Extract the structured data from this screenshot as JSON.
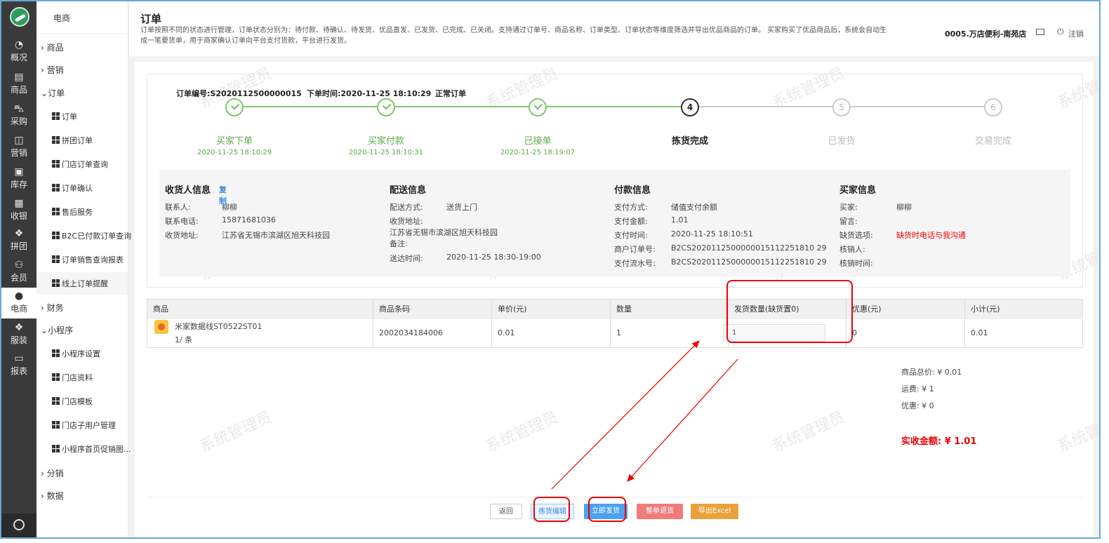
{
  "rail": {
    "items": [
      "概况",
      "商品",
      "采购",
      "营销",
      "库存",
      "收银",
      "拼团",
      "会员",
      "电商",
      "服装",
      "报表"
    ]
  },
  "sidebar": {
    "title": "电商",
    "groups": {
      "goods": "商品",
      "marketing": "营销",
      "order": "订单",
      "finance": "财务",
      "mini": "小程序",
      "dist": "分销",
      "data": "数据"
    },
    "order_items": [
      "订单",
      "拼团订单",
      "门店订单查询",
      "订单确认",
      "售后服务",
      "B2C已付款订单查询",
      "订单销售查询报表",
      "线上订单提醒"
    ],
    "mini_items": [
      "小程序设置",
      "门店资料",
      "门店模板",
      "门店子用户管理",
      "小程序首页促销图..."
    ]
  },
  "header": {
    "title": "订单",
    "desc": "订单按照不同的状态进行管理，订单状态分别为：待付款、待确认、待发货、优品直发、已发货、已完成、已关闭。支持通过订单号、商品名称、订单类型、订单状态等维度筛选并导出优品商品的订单。 买家购买了优品商品后，系统会自动生成一笔要货单，用于商家确认订单向平台支付货款，平台进行发货。",
    "shop": "0005.万店便利-南苑店",
    "logout": "注销"
  },
  "order": {
    "number": "订单编号:S2020112500000015",
    "time": "下单时间:2020-11-25 18:10:29",
    "type": "正常订单"
  },
  "steps": [
    {
      "num": "1",
      "label": "买家下单",
      "time": "2020-11-25 18:10:29",
      "state": "done"
    },
    {
      "num": "2",
      "label": "买家付款",
      "time": "2020-11-25 18:10:31",
      "state": "done"
    },
    {
      "num": "3",
      "label": "已接单",
      "time": "2020-11-25 18:19:07",
      "state": "done"
    },
    {
      "num": "4",
      "label": "拣货完成",
      "time": "",
      "state": "current"
    },
    {
      "num": "5",
      "label": "已发货",
      "time": "",
      "state": "todo"
    },
    {
      "num": "6",
      "label": "交易完成",
      "time": "",
      "state": "todo"
    }
  ],
  "receiver": {
    "title": "收货人信息",
    "copy": "复制",
    "contact_k": "联系人:",
    "contact_v": "柳柳",
    "phone_k": "联系电话:",
    "phone_v": "15871681036",
    "addr_k": "收货地址:",
    "addr_v": "江苏省无锡市滨湖区旭天科技园"
  },
  "delivery": {
    "title": "配送信息",
    "method_k": "配送方式:",
    "method_v": "送货上门",
    "addr_k": "收货地址:",
    "addr_v": "江苏省无锡市滨湖区旭天科技园",
    "note_k": "备注:",
    "time_k": "送达时间:",
    "time_v": "2020-11-25 18:30-19:00"
  },
  "payment": {
    "title": "付款信息",
    "method_k": "支付方式:",
    "method_v": "储值支付余额",
    "amount_k": "支付金额:",
    "amount_v": "1.01",
    "time_k": "支付时间:",
    "time_v": "2020-11-25 18:10:51",
    "merchant_k": "商户订单号:",
    "merchant_v": "B2CS2020112500000015112251810 29",
    "serial_k": "支付流水号:",
    "serial_v": "B2CS2020112500000015112251810 29"
  },
  "buyer": {
    "title": "买家信息",
    "buyer_k": "买家:",
    "buyer_v": "柳柳",
    "msg_k": "留言:",
    "short_k": "缺货选项:",
    "short_v": "缺货时电话与我沟通",
    "verifier_k": "核销人:",
    "vtime_k": "核销时间:"
  },
  "table": {
    "headers": [
      "商品",
      "商品条码",
      "单价(元)",
      "数量",
      "发货数量(缺货置0)",
      "优惠(元)",
      "小计(元)"
    ],
    "row": {
      "name": "米家数据线ST0522ST01",
      "unit": "1/ 条",
      "barcode": "2002034184006",
      "price": "0.01",
      "qty": "1",
      "ship_qty": "1",
      "discount": "0",
      "subtotal": "0.01"
    }
  },
  "summary": {
    "goods_total": "商品总价: ¥ 0.01",
    "freight": "运费: ¥ 1",
    "discount": "优惠: ¥ 0",
    "received": "实收金额: ¥ 1.01"
  },
  "buttons": {
    "back": "返回",
    "pick_edit": "拣货编辑",
    "ship_now": "立即发货",
    "refund_all": "整单退货",
    "export": "导出Excel"
  },
  "watermark": "系统管理员",
  "colors": {
    "done_green": "#6bbf57",
    "link_blue": "#3b8be6",
    "alert_red": "#e00000",
    "ship_blue": "#4aa3f0",
    "refund_red": "#f07b7b",
    "export_orange": "#e9a23b"
  }
}
